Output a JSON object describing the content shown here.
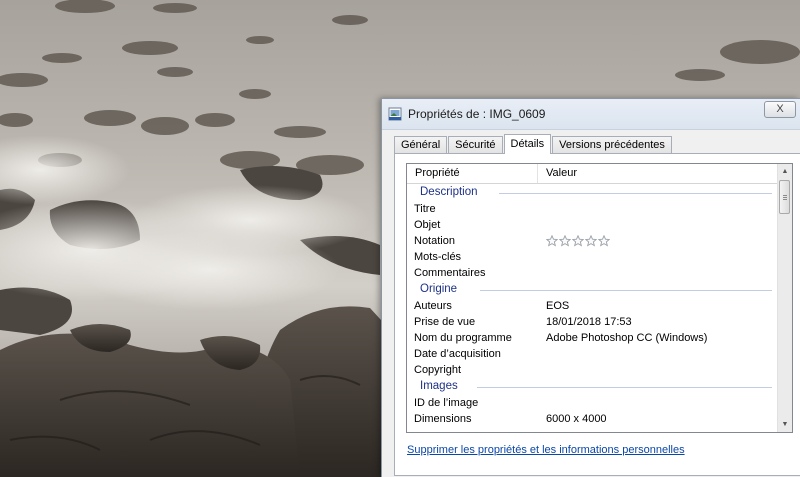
{
  "window": {
    "title": "Propriétés de : IMG_0609",
    "close_label": "X"
  },
  "tabs": [
    {
      "label": "Général",
      "active": false
    },
    {
      "label": "Sécurité",
      "active": false
    },
    {
      "label": "Détails",
      "active": true
    },
    {
      "label": "Versions précédentes",
      "active": false
    }
  ],
  "list": {
    "columns": {
      "property": "Propriété",
      "value": "Valeur"
    },
    "groups": {
      "description": {
        "title": "Description",
        "rows": {
          "titre": {
            "key": "Titre",
            "value": ""
          },
          "objet": {
            "key": "Objet",
            "value": ""
          },
          "notation": {
            "key": "Notation",
            "rating": 0,
            "max_rating": 5
          },
          "mots_cles": {
            "key": "Mots-clés",
            "value": ""
          },
          "commentaires": {
            "key": "Commentaires",
            "value": ""
          }
        }
      },
      "origine": {
        "title": "Origine",
        "rows": {
          "auteurs": {
            "key": "Auteurs",
            "value": "EOS"
          },
          "prise_de_vue": {
            "key": "Prise de vue",
            "value": "18/01/2018 17:53"
          },
          "programme": {
            "key": "Nom du programme",
            "value": "Adobe Photoshop CC (Windows)"
          },
          "acquisition": {
            "key": "Date d’acquisition",
            "value": ""
          },
          "copyright": {
            "key": "Copyright",
            "value": ""
          }
        }
      },
      "images": {
        "title": "Images",
        "rows": {
          "id_image": {
            "key": "ID de l’image",
            "value": ""
          },
          "dimensions": {
            "key": "Dimensions",
            "value": "6000 x 4000"
          }
        }
      }
    }
  },
  "remove_link": "Supprimer les propriétés et les informations personnelles",
  "colors": {
    "group_heading": "#1e3287",
    "link": "#0a47a8",
    "window_bg": "#f0f0f0"
  }
}
